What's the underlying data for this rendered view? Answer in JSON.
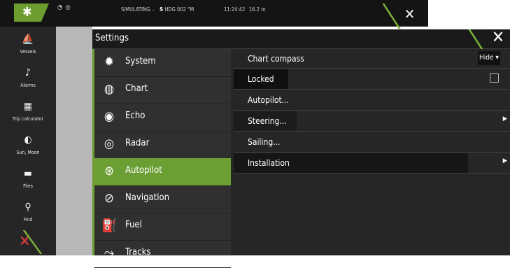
{
  "topbar": {
    "status_left": "SIMULATING...",
    "sog_label": "S",
    "hdg": "HDG 002",
    "hdg_unit": "°M",
    "time": "11:24:42",
    "depth": "16.2 m"
  },
  "sidebar": {
    "items": [
      {
        "label": "Vessels",
        "icon": "vessels-icon"
      },
      {
        "label": "Alarms",
        "icon": "bell-icon"
      },
      {
        "label": "Trip calculator",
        "icon": "calculator-icon"
      },
      {
        "label": "Sun, Moon",
        "icon": "sun-moon-icon"
      },
      {
        "label": "Files",
        "icon": "folder-icon"
      },
      {
        "label": "Find",
        "icon": "search-icon"
      }
    ]
  },
  "dialog": {
    "title": "Settings"
  },
  "menu": {
    "items": [
      {
        "label": "System",
        "icon": "gear-icon"
      },
      {
        "label": "Chart",
        "icon": "chart-icon"
      },
      {
        "label": "Echo",
        "icon": "echo-icon"
      },
      {
        "label": "Radar",
        "icon": "radar-icon"
      },
      {
        "label": "Autopilot",
        "icon": "autopilot-icon"
      },
      {
        "label": "Navigation",
        "icon": "navigation-icon"
      },
      {
        "label": "Fuel",
        "icon": "fuel-icon"
      },
      {
        "label": "Tracks",
        "icon": "tracks-icon"
      }
    ],
    "selected": "Autopilot"
  },
  "content": {
    "chart_compass": {
      "label": "Chart compass",
      "value": "Hide"
    },
    "locked": {
      "label": "Locked",
      "checked": false
    },
    "rows": [
      "Autopilot...",
      "Steering...",
      "Sailing...",
      "Installation"
    ]
  },
  "colors": {
    "accent": "#6b9e33",
    "background": "#262626",
    "close_alert": "#e33b3b"
  }
}
